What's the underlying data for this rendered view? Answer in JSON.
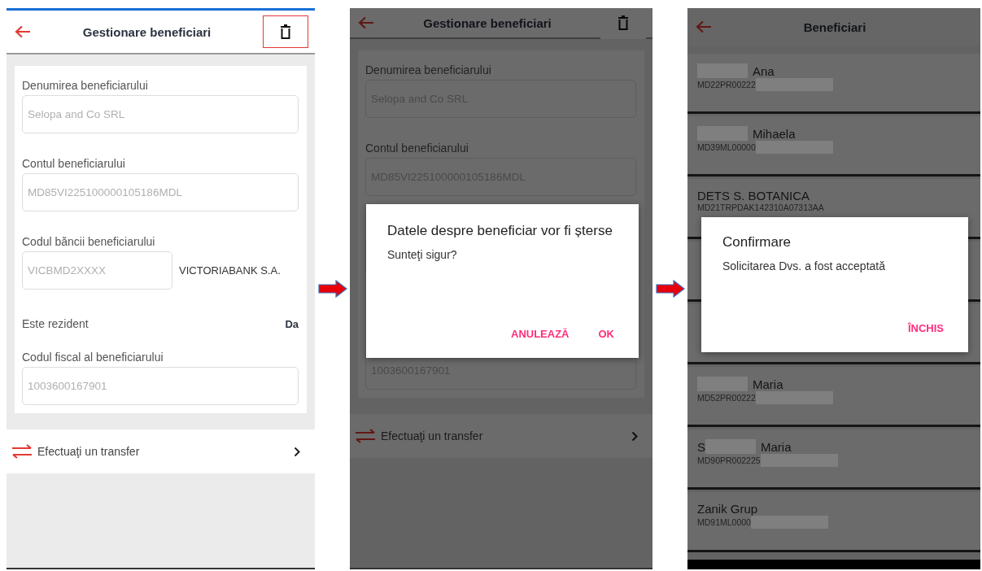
{
  "screens": [
    {
      "kind": "form",
      "dimmed": false,
      "header": {
        "title": "Gestionare beneficiari",
        "delete_highlighted": true
      },
      "fields": [
        {
          "kind": "text",
          "label": "Denumirea beneficiarului",
          "value": "Selopa and Co SRL"
        },
        {
          "kind": "text",
          "label": "Contul beneficiarului",
          "value": "MD85VI225100000105186MDL"
        },
        {
          "kind": "bank",
          "label": "Codul băncii beneficiarului",
          "value": "VICBMD2XXXX",
          "bank_name": "VICTORIABANK S.A."
        },
        {
          "kind": "resident",
          "label": "Este rezident",
          "value": "Da"
        },
        {
          "kind": "text",
          "label": "Codul fiscal al beneficiarului",
          "value": "1003600167901"
        }
      ],
      "transfer_link": "Efectuaţi un transfer"
    },
    {
      "kind": "form",
      "dimmed": true,
      "header": {
        "title": "Gestionare beneficiari",
        "delete_highlighted": false
      },
      "fields": [
        {
          "kind": "text",
          "label": "Denumirea beneficiarului",
          "value": "Selopa and Co SRL"
        },
        {
          "kind": "text",
          "label": "Contul beneficiarului",
          "value": "MD85VI225100000105186MDL"
        },
        {
          "kind": "bank"
        },
        {
          "kind": "resident"
        },
        {
          "kind": "text",
          "value": "1003600167901"
        }
      ],
      "transfer_link": "Efectuaţi un transfer",
      "dialog": {
        "title": "Datele despre beneficiar vor fi șterse",
        "message": "Sunteţi sigur?",
        "buttons": [
          "ANULEAZĂ",
          "OK"
        ]
      }
    },
    {
      "kind": "list",
      "dimmed": true,
      "header": {
        "title": "Beneficiari"
      },
      "rows": [
        {
          "name": "Ana",
          "name_redacted": true,
          "account": "MD22PR00222",
          "account_redacted": true
        },
        {
          "name": "Mihaela",
          "name_redacted": true,
          "account": "MD39ML00000",
          "account_redacted": true
        },
        {
          "name": "DETS S. BOTANICA",
          "name_redacted": false,
          "account": "MD21TRPDAK142310A07313AA",
          "account_redacted": false
        },
        {},
        {},
        {
          "name": "Maria",
          "name_redacted": true,
          "account": "MD52PR00222",
          "account_redacted": true
        },
        {
          "name_initial": "S",
          "name": "Maria",
          "name_redacted": true,
          "account": "MD90PR002225",
          "account_redacted": true
        },
        {
          "name": "Zanik Grup",
          "name_redacted": false,
          "account": "MD91ML0000",
          "account_redacted": true
        }
      ],
      "dialog": {
        "title": "Confirmare",
        "message": "Solicitarea Dvs. a fost acceptată",
        "buttons": [
          "ÎNCHIS"
        ]
      }
    }
  ]
}
